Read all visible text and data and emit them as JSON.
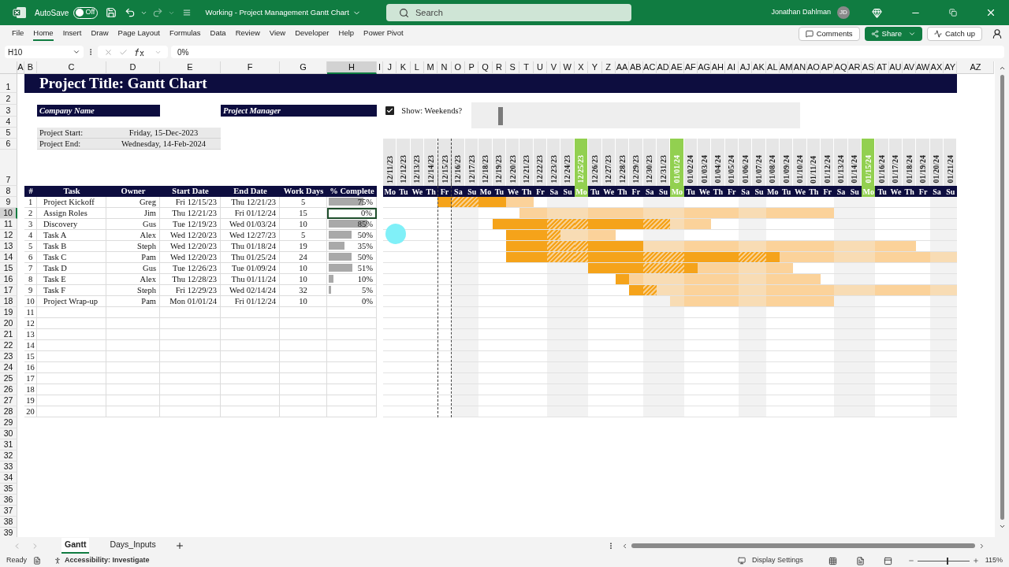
{
  "title_bar": {
    "autosave_label": "AutoSave",
    "autosave": {
      "label": "Off",
      "on": false
    },
    "document_title": "Working - Project Management Gantt Chart",
    "search": {
      "placeholder": "Search"
    },
    "user_name": "Jonathan Dahlman",
    "user_initials": "JD"
  },
  "ribbon": {
    "tabs": [
      {
        "label": "File",
        "selected": false
      },
      {
        "label": "Home",
        "selected": true
      },
      {
        "label": "Insert",
        "selected": false
      },
      {
        "label": "Draw",
        "selected": false
      },
      {
        "label": "Page Layout",
        "selected": false
      },
      {
        "label": "Formulas",
        "selected": false
      },
      {
        "label": "Data",
        "selected": false
      },
      {
        "label": "Review",
        "selected": false
      },
      {
        "label": "View",
        "selected": false
      },
      {
        "label": "Developer",
        "selected": false
      },
      {
        "label": "Help",
        "selected": false
      },
      {
        "label": "Power Pivot",
        "selected": false
      }
    ],
    "comments": "Comments",
    "share": "Share",
    "catch_up": "Catch up"
  },
  "formula_bar": {
    "name_box": "H10",
    "formula": "0%"
  },
  "columns": [
    {
      "label": "A",
      "selected": false
    },
    {
      "label": "B",
      "selected": false
    },
    {
      "label": "C",
      "selected": false
    },
    {
      "label": "D",
      "selected": false
    },
    {
      "label": "E",
      "selected": false
    },
    {
      "label": "F",
      "selected": false
    },
    {
      "label": "G",
      "selected": false
    },
    {
      "label": "H",
      "selected": true
    },
    {
      "label": "I",
      "selected": false
    },
    {
      "label": "J",
      "selected": false
    },
    {
      "label": "K",
      "selected": false
    },
    {
      "label": "L",
      "selected": false
    },
    {
      "label": "M",
      "selected": false
    },
    {
      "label": "N",
      "selected": false
    },
    {
      "label": "O",
      "selected": false
    },
    {
      "label": "P",
      "selected": false
    },
    {
      "label": "Q",
      "selected": false
    },
    {
      "label": "R",
      "selected": false
    },
    {
      "label": "S",
      "selected": false
    },
    {
      "label": "T",
      "selected": false
    },
    {
      "label": "U",
      "selected": false
    },
    {
      "label": "V",
      "selected": false
    },
    {
      "label": "W",
      "selected": false
    },
    {
      "label": "X",
      "selected": false
    },
    {
      "label": "Y",
      "selected": false
    },
    {
      "label": "Z",
      "selected": false
    },
    {
      "label": "AA",
      "selected": false
    },
    {
      "label": "AB",
      "selected": false
    },
    {
      "label": "AC",
      "selected": false
    },
    {
      "label": "AD",
      "selected": false
    },
    {
      "label": "AE",
      "selected": false
    },
    {
      "label": "AF",
      "selected": false
    },
    {
      "label": "AG",
      "selected": false
    },
    {
      "label": "AH",
      "selected": false
    },
    {
      "label": "AI",
      "selected": false
    },
    {
      "label": "AJ",
      "selected": false
    },
    {
      "label": "AK",
      "selected": false
    },
    {
      "label": "AL",
      "selected": false
    },
    {
      "label": "AM",
      "selected": false
    },
    {
      "label": "AN",
      "selected": false
    },
    {
      "label": "AO",
      "selected": false
    },
    {
      "label": "AP",
      "selected": false
    },
    {
      "label": "AQ",
      "selected": false
    },
    {
      "label": "AR",
      "selected": false
    },
    {
      "label": "AS",
      "selected": false
    },
    {
      "label": "AT",
      "selected": false
    },
    {
      "label": "AU",
      "selected": false
    },
    {
      "label": "AV",
      "selected": false
    },
    {
      "label": "AW",
      "selected": false
    },
    {
      "label": "AX",
      "selected": false
    },
    {
      "label": "AY",
      "selected": false
    },
    {
      "label": "AZ",
      "selected": false
    }
  ],
  "rows": [
    {
      "label": "1",
      "selected": false
    },
    {
      "label": "2",
      "selected": false
    },
    {
      "label": "3",
      "selected": false
    },
    {
      "label": "4",
      "selected": false
    },
    {
      "label": "5",
      "selected": false
    },
    {
      "label": "6",
      "selected": false
    },
    {
      "label": "7",
      "selected": false
    },
    {
      "label": "8",
      "selected": false
    },
    {
      "label": "9",
      "selected": false
    },
    {
      "label": "10",
      "selected": true
    },
    {
      "label": "11",
      "selected": false
    },
    {
      "label": "12",
      "selected": false
    },
    {
      "label": "13",
      "selected": false
    },
    {
      "label": "14",
      "selected": false
    },
    {
      "label": "15",
      "selected": false
    },
    {
      "label": "16",
      "selected": false
    },
    {
      "label": "17",
      "selected": false
    },
    {
      "label": "18",
      "selected": false
    },
    {
      "label": "19",
      "selected": false
    },
    {
      "label": "20",
      "selected": false
    },
    {
      "label": "21",
      "selected": false
    },
    {
      "label": "22",
      "selected": false
    },
    {
      "label": "23",
      "selected": false
    },
    {
      "label": "24",
      "selected": false
    },
    {
      "label": "25",
      "selected": false
    },
    {
      "label": "26",
      "selected": false
    },
    {
      "label": "27",
      "selected": false
    },
    {
      "label": "28",
      "selected": false
    },
    {
      "label": "29",
      "selected": false
    },
    {
      "label": "30",
      "selected": false
    },
    {
      "label": "31",
      "selected": false
    },
    {
      "label": "32",
      "selected": false
    },
    {
      "label": "33",
      "selected": false
    },
    {
      "label": "34",
      "selected": false
    },
    {
      "label": "35",
      "selected": false
    },
    {
      "label": "36",
      "selected": false
    },
    {
      "label": "37",
      "selected": false
    },
    {
      "label": "38",
      "selected": false
    },
    {
      "label": "39",
      "selected": false
    }
  ],
  "sheet": {
    "title": "Project Title: Gantt Chart",
    "company_name": "Company Name",
    "project_manager": "Project Manager",
    "show_weekends": {
      "label": "Show: Weekends?",
      "checked": true
    },
    "project_start": {
      "label": "Project Start:",
      "value": "Friday, 15-Dec-2023"
    },
    "project_end": {
      "label": "Project End:",
      "value": "Wednesday, 14-Feb-2024"
    },
    "table_columns": [
      "#",
      "Task",
      "Owner",
      "Start Date",
      "End Date",
      "Work Days",
      "% Complete"
    ],
    "days": [
      {
        "date": "12/11/23",
        "day": "Mo",
        "kind": "workday",
        "today": false
      },
      {
        "date": "12/12/23",
        "day": "Tu",
        "kind": "workday",
        "today": false
      },
      {
        "date": "12/13/23",
        "day": "We",
        "kind": "workday",
        "today": false
      },
      {
        "date": "12/14/23",
        "day": "Th",
        "kind": "workday",
        "today": false
      },
      {
        "date": "12/15/23",
        "day": "Fr",
        "kind": "workday",
        "today": true
      },
      {
        "date": "12/16/23",
        "day": "Sa",
        "kind": "weekend",
        "today": false
      },
      {
        "date": "12/17/23",
        "day": "Su",
        "kind": "weekend",
        "today": false
      },
      {
        "date": "12/18/23",
        "day": "Mo",
        "kind": "workday",
        "today": false
      },
      {
        "date": "12/19/23",
        "day": "Tu",
        "kind": "workday",
        "today": false
      },
      {
        "date": "12/20/23",
        "day": "We",
        "kind": "workday",
        "today": false
      },
      {
        "date": "12/21/23",
        "day": "Th",
        "kind": "workday",
        "today": false
      },
      {
        "date": "12/22/23",
        "day": "Fr",
        "kind": "workday",
        "today": false
      },
      {
        "date": "12/23/23",
        "day": "Sa",
        "kind": "weekend",
        "today": false
      },
      {
        "date": "12/24/23",
        "day": "Su",
        "kind": "weekend",
        "today": false
      },
      {
        "date": "12/25/23",
        "day": "Mo",
        "kind": "holiday",
        "today": false
      },
      {
        "date": "12/26/23",
        "day": "Tu",
        "kind": "workday",
        "today": false
      },
      {
        "date": "12/27/23",
        "day": "We",
        "kind": "workday",
        "today": false
      },
      {
        "date": "12/28/23",
        "day": "Th",
        "kind": "workday",
        "today": false
      },
      {
        "date": "12/29/23",
        "day": "Fr",
        "kind": "workday",
        "today": false
      },
      {
        "date": "12/30/23",
        "day": "Sa",
        "kind": "weekend",
        "today": false
      },
      {
        "date": "12/31/23",
        "day": "Su",
        "kind": "weekend",
        "today": false
      },
      {
        "date": "01/01/24",
        "day": "Mo",
        "kind": "holiday",
        "today": false
      },
      {
        "date": "01/02/24",
        "day": "Tu",
        "kind": "workday",
        "today": false
      },
      {
        "date": "01/03/24",
        "day": "We",
        "kind": "workday",
        "today": false
      },
      {
        "date": "01/04/24",
        "day": "Th",
        "kind": "workday",
        "today": false
      },
      {
        "date": "01/05/24",
        "day": "Fr",
        "kind": "workday",
        "today": false
      },
      {
        "date": "01/06/24",
        "day": "Sa",
        "kind": "weekend",
        "today": false
      },
      {
        "date": "01/07/24",
        "day": "Su",
        "kind": "weekend",
        "today": false
      },
      {
        "date": "01/08/24",
        "day": "Mo",
        "kind": "workday",
        "today": false
      },
      {
        "date": "01/09/24",
        "day": "Tu",
        "kind": "workday",
        "today": false
      },
      {
        "date": "01/10/24",
        "day": "We",
        "kind": "workday",
        "today": false
      },
      {
        "date": "01/11/24",
        "day": "Th",
        "kind": "workday",
        "today": false
      },
      {
        "date": "01/12/24",
        "day": "Fr",
        "kind": "workday",
        "today": false
      },
      {
        "date": "01/13/24",
        "day": "Sa",
        "kind": "weekend",
        "today": false
      },
      {
        "date": "01/14/24",
        "day": "Su",
        "kind": "weekend",
        "today": false
      },
      {
        "date": "01/15/24",
        "day": "Mo",
        "kind": "holiday",
        "today": false
      },
      {
        "date": "01/16/24",
        "day": "Tu",
        "kind": "workday",
        "today": false
      },
      {
        "date": "01/17/24",
        "day": "We",
        "kind": "workday",
        "today": false
      },
      {
        "date": "01/18/24",
        "day": "Th",
        "kind": "workday",
        "today": false
      },
      {
        "date": "01/19/24",
        "day": "Fr",
        "kind": "workday",
        "today": false
      },
      {
        "date": "01/20/24",
        "day": "Sa",
        "kind": "weekend",
        "today": false
      },
      {
        "date": "01/21/24",
        "day": "Su",
        "kind": "weekend",
        "today": false
      }
    ],
    "tasks": [
      {
        "number": "1",
        "task": "Project Kickoff",
        "owner": "Greg",
        "start": "Fri 12/15/23",
        "end": "Thu 12/21/23",
        "work_days": "5",
        "percent": "75%",
        "level": 0.75,
        "selected": false,
        "cells": [
          {
            "kind": "none"
          },
          {
            "kind": "none"
          },
          {
            "kind": "none"
          },
          {
            "kind": "none"
          },
          {
            "kind": "done"
          },
          {
            "kind": "done"
          },
          {
            "kind": "done"
          },
          {
            "kind": "done"
          },
          {
            "kind": "done"
          },
          {
            "kind": "todo"
          },
          {
            "kind": "todo"
          },
          {
            "kind": "none"
          },
          {
            "kind": "none"
          },
          {
            "kind": "none"
          },
          {
            "kind": "none"
          },
          {
            "kind": "none"
          },
          {
            "kind": "none"
          },
          {
            "kind": "none"
          },
          {
            "kind": "none"
          },
          {
            "kind": "none"
          },
          {
            "kind": "none"
          },
          {
            "kind": "none"
          },
          {
            "kind": "none"
          },
          {
            "kind": "none"
          },
          {
            "kind": "none"
          },
          {
            "kind": "none"
          },
          {
            "kind": "none"
          },
          {
            "kind": "none"
          },
          {
            "kind": "none"
          },
          {
            "kind": "none"
          },
          {
            "kind": "none"
          },
          {
            "kind": "none"
          },
          {
            "kind": "none"
          },
          {
            "kind": "none"
          },
          {
            "kind": "none"
          },
          {
            "kind": "none"
          },
          {
            "kind": "none"
          },
          {
            "kind": "none"
          },
          {
            "kind": "none"
          },
          {
            "kind": "none"
          },
          {
            "kind": "none"
          },
          {
            "kind": "none"
          }
        ]
      },
      {
        "number": "2",
        "task": "Assign Roles",
        "owner": "Jim",
        "start": "Thu 12/21/23",
        "end": "Fri 01/12/24",
        "work_days": "15",
        "percent": "0%",
        "level": 0,
        "selected": true,
        "cells": [
          {
            "kind": "none"
          },
          {
            "kind": "none"
          },
          {
            "kind": "none"
          },
          {
            "kind": "none"
          },
          {
            "kind": "none"
          },
          {
            "kind": "none"
          },
          {
            "kind": "none"
          },
          {
            "kind": "none"
          },
          {
            "kind": "none"
          },
          {
            "kind": "none"
          },
          {
            "kind": "todo"
          },
          {
            "kind": "todo"
          },
          {
            "kind": "todo"
          },
          {
            "kind": "todo"
          },
          {
            "kind": "todo"
          },
          {
            "kind": "todo"
          },
          {
            "kind": "todo"
          },
          {
            "kind": "todo"
          },
          {
            "kind": "todo"
          },
          {
            "kind": "todo"
          },
          {
            "kind": "todo"
          },
          {
            "kind": "todo"
          },
          {
            "kind": "todo"
          },
          {
            "kind": "todo"
          },
          {
            "kind": "todo"
          },
          {
            "kind": "todo"
          },
          {
            "kind": "todo"
          },
          {
            "kind": "todo"
          },
          {
            "kind": "todo"
          },
          {
            "kind": "todo"
          },
          {
            "kind": "todo"
          },
          {
            "kind": "todo"
          },
          {
            "kind": "todo"
          },
          {
            "kind": "none"
          },
          {
            "kind": "none"
          },
          {
            "kind": "none"
          },
          {
            "kind": "none"
          },
          {
            "kind": "none"
          },
          {
            "kind": "none"
          },
          {
            "kind": "none"
          },
          {
            "kind": "none"
          },
          {
            "kind": "none"
          }
        ]
      },
      {
        "number": "3",
        "task": "Discovery",
        "owner": "Gus",
        "start": "Tue 12/19/23",
        "end": "Wed 01/03/24",
        "work_days": "10",
        "percent": "85%",
        "level": 0.85,
        "selected": false,
        "cells": [
          {
            "kind": "none"
          },
          {
            "kind": "none"
          },
          {
            "kind": "none"
          },
          {
            "kind": "none"
          },
          {
            "kind": "none"
          },
          {
            "kind": "none"
          },
          {
            "kind": "none"
          },
          {
            "kind": "none"
          },
          {
            "kind": "done"
          },
          {
            "kind": "done"
          },
          {
            "kind": "done"
          },
          {
            "kind": "done"
          },
          {
            "kind": "done"
          },
          {
            "kind": "done"
          },
          {
            "kind": "done"
          },
          {
            "kind": "done"
          },
          {
            "kind": "done"
          },
          {
            "kind": "done"
          },
          {
            "kind": "done"
          },
          {
            "kind": "done"
          },
          {
            "kind": "done"
          },
          {
            "kind": "todo"
          },
          {
            "kind": "todo"
          },
          {
            "kind": "todo"
          },
          {
            "kind": "none"
          },
          {
            "kind": "none"
          },
          {
            "kind": "none"
          },
          {
            "kind": "none"
          },
          {
            "kind": "none"
          },
          {
            "kind": "none"
          },
          {
            "kind": "none"
          },
          {
            "kind": "none"
          },
          {
            "kind": "none"
          },
          {
            "kind": "none"
          },
          {
            "kind": "none"
          },
          {
            "kind": "none"
          },
          {
            "kind": "none"
          },
          {
            "kind": "none"
          },
          {
            "kind": "none"
          },
          {
            "kind": "none"
          },
          {
            "kind": "none"
          },
          {
            "kind": "none"
          }
        ]
      },
      {
        "number": "4",
        "task": "Task A",
        "owner": "Alex",
        "start": "Wed 12/20/23",
        "end": "Wed 12/27/23",
        "work_days": "5",
        "percent": "50%",
        "level": 0.5,
        "selected": false,
        "cells": [
          {
            "kind": "none"
          },
          {
            "kind": "none"
          },
          {
            "kind": "none"
          },
          {
            "kind": "none"
          },
          {
            "kind": "none"
          },
          {
            "kind": "none"
          },
          {
            "kind": "none"
          },
          {
            "kind": "none"
          },
          {
            "kind": "none"
          },
          {
            "kind": "done"
          },
          {
            "kind": "done"
          },
          {
            "kind": "done"
          },
          {
            "kind": "done"
          },
          {
            "kind": "todo"
          },
          {
            "kind": "todo"
          },
          {
            "kind": "todo"
          },
          {
            "kind": "todo"
          },
          {
            "kind": "none"
          },
          {
            "kind": "none"
          },
          {
            "kind": "none"
          },
          {
            "kind": "none"
          },
          {
            "kind": "none"
          },
          {
            "kind": "none"
          },
          {
            "kind": "none"
          },
          {
            "kind": "none"
          },
          {
            "kind": "none"
          },
          {
            "kind": "none"
          },
          {
            "kind": "none"
          },
          {
            "kind": "none"
          },
          {
            "kind": "none"
          },
          {
            "kind": "none"
          },
          {
            "kind": "none"
          },
          {
            "kind": "none"
          },
          {
            "kind": "none"
          },
          {
            "kind": "none"
          },
          {
            "kind": "none"
          },
          {
            "kind": "none"
          },
          {
            "kind": "none"
          },
          {
            "kind": "none"
          },
          {
            "kind": "none"
          },
          {
            "kind": "none"
          },
          {
            "kind": "none"
          }
        ]
      },
      {
        "number": "5",
        "task": "Task B",
        "owner": "Steph",
        "start": "Wed 12/20/23",
        "end": "Thu 01/18/24",
        "work_days": "19",
        "percent": "35%",
        "level": 0.35,
        "selected": false,
        "cells": [
          {
            "kind": "none"
          },
          {
            "kind": "none"
          },
          {
            "kind": "none"
          },
          {
            "kind": "none"
          },
          {
            "kind": "none"
          },
          {
            "kind": "none"
          },
          {
            "kind": "none"
          },
          {
            "kind": "none"
          },
          {
            "kind": "none"
          },
          {
            "kind": "done"
          },
          {
            "kind": "done"
          },
          {
            "kind": "done"
          },
          {
            "kind": "done"
          },
          {
            "kind": "done"
          },
          {
            "kind": "done"
          },
          {
            "kind": "done"
          },
          {
            "kind": "done"
          },
          {
            "kind": "done"
          },
          {
            "kind": "done"
          },
          {
            "kind": "todo"
          },
          {
            "kind": "todo"
          },
          {
            "kind": "todo"
          },
          {
            "kind": "todo"
          },
          {
            "kind": "todo"
          },
          {
            "kind": "todo"
          },
          {
            "kind": "todo"
          },
          {
            "kind": "todo"
          },
          {
            "kind": "todo"
          },
          {
            "kind": "todo"
          },
          {
            "kind": "todo"
          },
          {
            "kind": "todo"
          },
          {
            "kind": "todo"
          },
          {
            "kind": "todo"
          },
          {
            "kind": "todo"
          },
          {
            "kind": "todo"
          },
          {
            "kind": "todo"
          },
          {
            "kind": "todo"
          },
          {
            "kind": "todo"
          },
          {
            "kind": "todo"
          },
          {
            "kind": "none"
          },
          {
            "kind": "none"
          },
          {
            "kind": "none"
          }
        ]
      },
      {
        "number": "6",
        "task": "Task C",
        "owner": "Pam",
        "start": "Wed 12/20/23",
        "end": "Thu 01/25/24",
        "work_days": "24",
        "percent": "50%",
        "level": 0.5,
        "selected": false,
        "cells": [
          {
            "kind": "none"
          },
          {
            "kind": "none"
          },
          {
            "kind": "none"
          },
          {
            "kind": "none"
          },
          {
            "kind": "none"
          },
          {
            "kind": "none"
          },
          {
            "kind": "none"
          },
          {
            "kind": "none"
          },
          {
            "kind": "none"
          },
          {
            "kind": "done"
          },
          {
            "kind": "done"
          },
          {
            "kind": "done"
          },
          {
            "kind": "done"
          },
          {
            "kind": "done"
          },
          {
            "kind": "done"
          },
          {
            "kind": "done"
          },
          {
            "kind": "done"
          },
          {
            "kind": "done"
          },
          {
            "kind": "done"
          },
          {
            "kind": "done"
          },
          {
            "kind": "done"
          },
          {
            "kind": "done"
          },
          {
            "kind": "done"
          },
          {
            "kind": "done"
          },
          {
            "kind": "done"
          },
          {
            "kind": "done"
          },
          {
            "kind": "done"
          },
          {
            "kind": "done"
          },
          {
            "kind": "done"
          },
          {
            "kind": "todo"
          },
          {
            "kind": "todo"
          },
          {
            "kind": "todo"
          },
          {
            "kind": "todo"
          },
          {
            "kind": "todo"
          },
          {
            "kind": "todo"
          },
          {
            "kind": "todo"
          },
          {
            "kind": "todo"
          },
          {
            "kind": "todo"
          },
          {
            "kind": "todo"
          },
          {
            "kind": "todo"
          },
          {
            "kind": "todo"
          },
          {
            "kind": "todo"
          }
        ]
      },
      {
        "number": "7",
        "task": "Task D",
        "owner": "Gus",
        "start": "Tue 12/26/23",
        "end": "Tue 01/09/24",
        "work_days": "10",
        "percent": "51%",
        "level": 0.51,
        "selected": false,
        "cells": [
          {
            "kind": "none"
          },
          {
            "kind": "none"
          },
          {
            "kind": "none"
          },
          {
            "kind": "none"
          },
          {
            "kind": "none"
          },
          {
            "kind": "none"
          },
          {
            "kind": "none"
          },
          {
            "kind": "none"
          },
          {
            "kind": "none"
          },
          {
            "kind": "none"
          },
          {
            "kind": "none"
          },
          {
            "kind": "none"
          },
          {
            "kind": "none"
          },
          {
            "kind": "none"
          },
          {
            "kind": "none"
          },
          {
            "kind": "done"
          },
          {
            "kind": "done"
          },
          {
            "kind": "done"
          },
          {
            "kind": "done"
          },
          {
            "kind": "done"
          },
          {
            "kind": "done"
          },
          {
            "kind": "done"
          },
          {
            "kind": "done"
          },
          {
            "kind": "todo"
          },
          {
            "kind": "todo"
          },
          {
            "kind": "todo"
          },
          {
            "kind": "todo"
          },
          {
            "kind": "todo"
          },
          {
            "kind": "todo"
          },
          {
            "kind": "todo"
          },
          {
            "kind": "none"
          },
          {
            "kind": "none"
          },
          {
            "kind": "none"
          },
          {
            "kind": "none"
          },
          {
            "kind": "none"
          },
          {
            "kind": "none"
          },
          {
            "kind": "none"
          },
          {
            "kind": "none"
          },
          {
            "kind": "none"
          },
          {
            "kind": "none"
          },
          {
            "kind": "none"
          },
          {
            "kind": "none"
          }
        ]
      },
      {
        "number": "8",
        "task": "Task E",
        "owner": "Alex",
        "start": "Thu 12/28/23",
        "end": "Thu 01/11/24",
        "work_days": "10",
        "percent": "10%",
        "level": 0.1,
        "selected": false,
        "cells": [
          {
            "kind": "none"
          },
          {
            "kind": "none"
          },
          {
            "kind": "none"
          },
          {
            "kind": "none"
          },
          {
            "kind": "none"
          },
          {
            "kind": "none"
          },
          {
            "kind": "none"
          },
          {
            "kind": "none"
          },
          {
            "kind": "none"
          },
          {
            "kind": "none"
          },
          {
            "kind": "none"
          },
          {
            "kind": "none"
          },
          {
            "kind": "none"
          },
          {
            "kind": "none"
          },
          {
            "kind": "none"
          },
          {
            "kind": "none"
          },
          {
            "kind": "none"
          },
          {
            "kind": "done"
          },
          {
            "kind": "todo"
          },
          {
            "kind": "todo"
          },
          {
            "kind": "todo"
          },
          {
            "kind": "todo"
          },
          {
            "kind": "todo"
          },
          {
            "kind": "todo"
          },
          {
            "kind": "todo"
          },
          {
            "kind": "todo"
          },
          {
            "kind": "todo"
          },
          {
            "kind": "todo"
          },
          {
            "kind": "todo"
          },
          {
            "kind": "todo"
          },
          {
            "kind": "todo"
          },
          {
            "kind": "todo"
          },
          {
            "kind": "none"
          },
          {
            "kind": "none"
          },
          {
            "kind": "none"
          },
          {
            "kind": "none"
          },
          {
            "kind": "none"
          },
          {
            "kind": "none"
          },
          {
            "kind": "none"
          },
          {
            "kind": "none"
          },
          {
            "kind": "none"
          },
          {
            "kind": "none"
          }
        ]
      },
      {
        "number": "9",
        "task": "Task F",
        "owner": "Steph",
        "start": "Fri 12/29/23",
        "end": "Wed 02/14/24",
        "work_days": "32",
        "percent": "5%",
        "level": 0.05,
        "selected": false,
        "cells": [
          {
            "kind": "none"
          },
          {
            "kind": "none"
          },
          {
            "kind": "none"
          },
          {
            "kind": "none"
          },
          {
            "kind": "none"
          },
          {
            "kind": "none"
          },
          {
            "kind": "none"
          },
          {
            "kind": "none"
          },
          {
            "kind": "none"
          },
          {
            "kind": "none"
          },
          {
            "kind": "none"
          },
          {
            "kind": "none"
          },
          {
            "kind": "none"
          },
          {
            "kind": "none"
          },
          {
            "kind": "none"
          },
          {
            "kind": "none"
          },
          {
            "kind": "none"
          },
          {
            "kind": "none"
          },
          {
            "kind": "done"
          },
          {
            "kind": "done"
          },
          {
            "kind": "todo"
          },
          {
            "kind": "todo"
          },
          {
            "kind": "todo"
          },
          {
            "kind": "todo"
          },
          {
            "kind": "todo"
          },
          {
            "kind": "todo"
          },
          {
            "kind": "todo"
          },
          {
            "kind": "todo"
          },
          {
            "kind": "todo"
          },
          {
            "kind": "todo"
          },
          {
            "kind": "todo"
          },
          {
            "kind": "todo"
          },
          {
            "kind": "todo"
          },
          {
            "kind": "todo"
          },
          {
            "kind": "todo"
          },
          {
            "kind": "todo"
          },
          {
            "kind": "todo"
          },
          {
            "kind": "todo"
          },
          {
            "kind": "todo"
          },
          {
            "kind": "todo"
          },
          {
            "kind": "todo"
          },
          {
            "kind": "todo"
          }
        ]
      },
      {
        "number": "10",
        "task": "Project Wrap-up",
        "owner": "Pam",
        "start": "Mon 01/01/24",
        "end": "Fri 01/12/24",
        "work_days": "10",
        "percent": "0%",
        "level": 0,
        "selected": false,
        "cells": [
          {
            "kind": "none"
          },
          {
            "kind": "none"
          },
          {
            "kind": "none"
          },
          {
            "kind": "none"
          },
          {
            "kind": "none"
          },
          {
            "kind": "none"
          },
          {
            "kind": "none"
          },
          {
            "kind": "none"
          },
          {
            "kind": "none"
          },
          {
            "kind": "none"
          },
          {
            "kind": "none"
          },
          {
            "kind": "none"
          },
          {
            "kind": "none"
          },
          {
            "kind": "none"
          },
          {
            "kind": "none"
          },
          {
            "kind": "none"
          },
          {
            "kind": "none"
          },
          {
            "kind": "none"
          },
          {
            "kind": "none"
          },
          {
            "kind": "none"
          },
          {
            "kind": "none"
          },
          {
            "kind": "todo"
          },
          {
            "kind": "todo"
          },
          {
            "kind": "todo"
          },
          {
            "kind": "todo"
          },
          {
            "kind": "todo"
          },
          {
            "kind": "todo"
          },
          {
            "kind": "todo"
          },
          {
            "kind": "todo"
          },
          {
            "kind": "todo"
          },
          {
            "kind": "todo"
          },
          {
            "kind": "todo"
          },
          {
            "kind": "todo"
          },
          {
            "kind": "none"
          },
          {
            "kind": "none"
          },
          {
            "kind": "none"
          },
          {
            "kind": "none"
          },
          {
            "kind": "none"
          },
          {
            "kind": "none"
          },
          {
            "kind": "none"
          },
          {
            "kind": "none"
          },
          {
            "kind": "none"
          }
        ]
      }
    ],
    "blank_rows": [
      "11",
      "12",
      "13",
      "14",
      "15",
      "16",
      "17",
      "18",
      "19",
      "20"
    ]
  },
  "sheet_tabs": [
    {
      "label": "Gantt",
      "selected": true
    },
    {
      "label": "Days_Inputs",
      "selected": false
    }
  ],
  "status_bar": {
    "ready": "Ready",
    "accessibility": "Accessibility: Investigate",
    "display_settings": "Display Settings",
    "zoom_slider": {
      "level": 0.57
    },
    "zoom": "115%"
  }
}
